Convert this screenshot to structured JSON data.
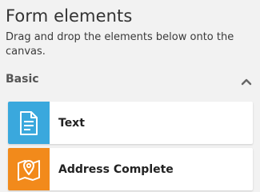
{
  "panel": {
    "title": "Form elements",
    "subtitle": "Drag and drop the elements below onto the canvas."
  },
  "section": {
    "label": "Basic",
    "collapse_icon": "chevron-up-icon"
  },
  "elements": [
    {
      "label": "Text",
      "icon": "document-text-icon",
      "color": "#3aa8dd"
    },
    {
      "label": "Address Complete",
      "icon": "map-pin-icon",
      "color": "#f28a1b"
    }
  ]
}
